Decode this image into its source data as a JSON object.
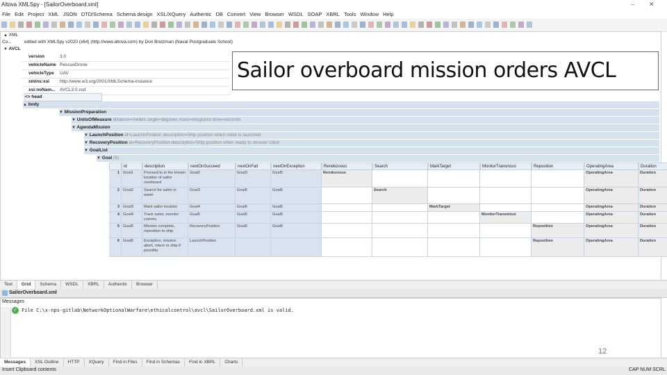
{
  "window": {
    "title": "Altova XMLSpy - [SailorOverboard.xml]",
    "menu": [
      "File",
      "Edit",
      "Project",
      "XML",
      "JSON",
      "DTD/Schema",
      "Schema design",
      "XSL/XQuery",
      "Authentic",
      "DB",
      "Convert",
      "View",
      "Browser",
      "WSDL",
      "SOAP",
      "XBRL",
      "Tools",
      "Window",
      "Help"
    ]
  },
  "tree": {
    "xml": "XML",
    "comment_label": "Co...",
    "comment": "edited with XMLSpy v2020 (x64) (http://www.altova.com) by Don Brutzman (Naval Postgraduate School)",
    "root": "AVCL",
    "attributes": [
      {
        "name": "version",
        "value": "3.0"
      },
      {
        "name": "vehicleName",
        "value": "RescueDrone"
      },
      {
        "name": "vehicleType",
        "value": "UAV"
      },
      {
        "name": "xmlns:xsi",
        "value": "http://www.w3.org/2001/XMLSchema-instance"
      },
      {
        "name": "xsi:noNam...",
        "value": "AVCL3.0.xsd"
      }
    ],
    "head": "head",
    "body": "body",
    "mission_prep": "MissionPreparation",
    "units": "UnitsOfMeasure",
    "units_value": "distance=meters angle=degrees mass=kilograms time=seconds",
    "agenda": "AgendaMission",
    "launch": "LaunchPosition",
    "launch_value": "id=LaunchPosition description=Ship position when robot is launched",
    "recovery": "RecoveryPosition",
    "recovery_value": "id=RecoveryPosition description=Ship position when ready to recover robot",
    "goallist": "GoalList",
    "goal": "Goal",
    "goal_count": "(6)"
  },
  "table": {
    "columns": [
      "id",
      "description",
      "nextOnSucceed",
      "nextOnFail",
      "nextOnException",
      "Rendezvous",
      "Search",
      "MarkTarget",
      "MonitorTransmissi",
      "Reposition",
      "OperatingArea",
      "Duration"
    ],
    "rows": [
      {
        "n": "1",
        "id": "Goal1",
        "desc": "Proceed to in the known location of sailor overboard",
        "succ": "Goal2",
        "fail": "Goal3",
        "exc": "Goal5",
        "rendez": "Rendezvous",
        "search": "",
        "mark": "",
        "monitor": "",
        "repos": "",
        "op": "OperatingArea",
        "dur": "Duration"
      },
      {
        "n": "2",
        "id": "Goal2",
        "desc": "Search for sailor in water",
        "succ": "Goal3",
        "fail": "Goal5",
        "exc": "Goal5",
        "rendez": "",
        "search": "Search",
        "mark": "",
        "monitor": "",
        "repos": "",
        "op": "OperatingArea",
        "dur": "Duration"
      },
      {
        "n": "3",
        "id": "Goal3",
        "desc": "Mark sailor location",
        "succ": "Goal4",
        "fail": "Goal5",
        "exc": "Goal5",
        "rendez": "",
        "search": "",
        "mark": "MarkTarget",
        "monitor": "",
        "repos": "",
        "op": "OperatingArea",
        "dur": "Duration"
      },
      {
        "n": "4",
        "id": "Goal4",
        "desc": "Track sailor, monitor comms",
        "succ": "Goal5",
        "fail": "Goal5",
        "exc": "Goal5",
        "rendez": "",
        "search": "",
        "mark": "",
        "monitor": "MonitorTransmissi",
        "repos": "",
        "op": "OperatingArea",
        "dur": "Duration"
      },
      {
        "n": "5",
        "id": "Goal5",
        "desc": "Mission complete, reposition to ship",
        "succ": "RecoveryPosition",
        "fail": "Goal6",
        "exc": "Goal6",
        "rendez": "",
        "search": "",
        "mark": "",
        "monitor": "",
        "repos": "Reposition",
        "op": "OperatingArea",
        "dur": "Duration"
      },
      {
        "n": "6",
        "id": "Goal6",
        "desc": "Exception, mission abort, return to ship if possible",
        "succ": "LaunchPosition",
        "fail": "",
        "exc": "",
        "rendez": "",
        "search": "",
        "mark": "",
        "monitor": "",
        "repos": "Reposition",
        "op": "OperatingArea",
        "dur": "Duration"
      }
    ],
    "rendez_extra": "descrip",
    "search_extra": "datumType=",
    "mark_extra": "descrip",
    "repos_extra": "descript"
  },
  "overlay_title": "Sailor overboard mission orders AVCL",
  "view_tabs": [
    "Text",
    "Grid",
    "Schema",
    "WSDL",
    "XBRL",
    "Authentic",
    "Browser"
  ],
  "file_tab": "SailorOverboard.xml",
  "messages": {
    "title": "Messages",
    "line": "File C:\\x-nps-gitlab\\NetworkOptionalWarfare\\ethicalcontrol\\avcl\\SailorOverboard.xml is valid."
  },
  "bottom_tabs": [
    "Messages",
    "XSL Outline",
    "HTTP",
    "XQuery",
    "Find in Files",
    "Find in Schemas",
    "Find in XBRL",
    "Charts"
  ],
  "page_number": "12",
  "status": {
    "left": "Insert Clipboard contents",
    "right": "CAP NUM SCRL"
  }
}
